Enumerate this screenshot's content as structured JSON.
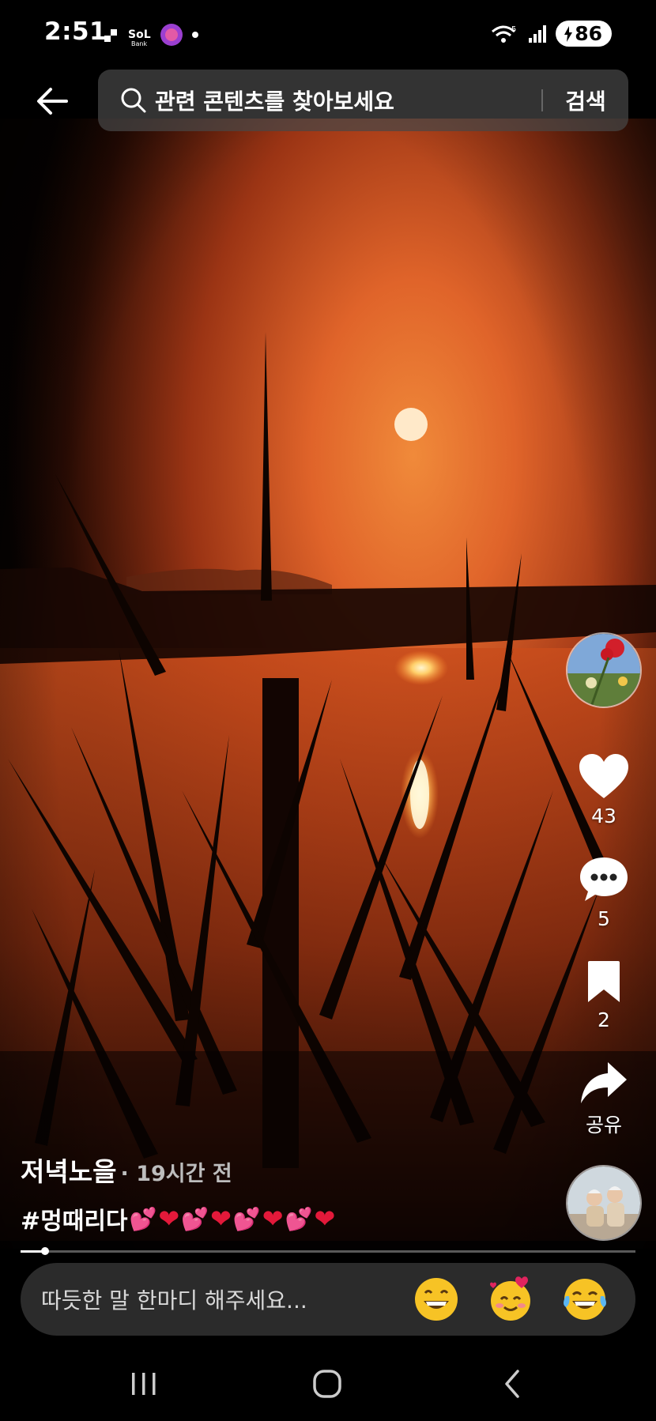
{
  "status_bar": {
    "time": "2:51",
    "battery": "86",
    "signal_badge": "5"
  },
  "search": {
    "placeholder": "관련 콘텐츠를 찾아보세요",
    "button_label": "검색"
  },
  "rail": {
    "like_count": "43",
    "comment_count": "5",
    "save_count": "2",
    "share_label": "공유"
  },
  "post": {
    "username": "저녁노을",
    "time_ago": "· 19시간 전",
    "hashtag": "#멍때리다",
    "progress": 0.04
  },
  "comment": {
    "placeholder": "따듯한 말 한마디 해주세요..."
  },
  "icons": {
    "back": "back-arrow-icon",
    "search": "search-icon",
    "like": "heart-icon",
    "comment": "comment-bubble-icon",
    "save": "bookmark-icon",
    "share": "share-arrow-icon",
    "nav_recent": "recent-apps-icon",
    "nav_home": "home-icon",
    "nav_back": "nav-back-icon"
  },
  "colors": {
    "background": "#000000",
    "sunset_orange": "#d4551c",
    "heart_red": "#e3193a",
    "comment_bar": "#2b2b2b"
  }
}
